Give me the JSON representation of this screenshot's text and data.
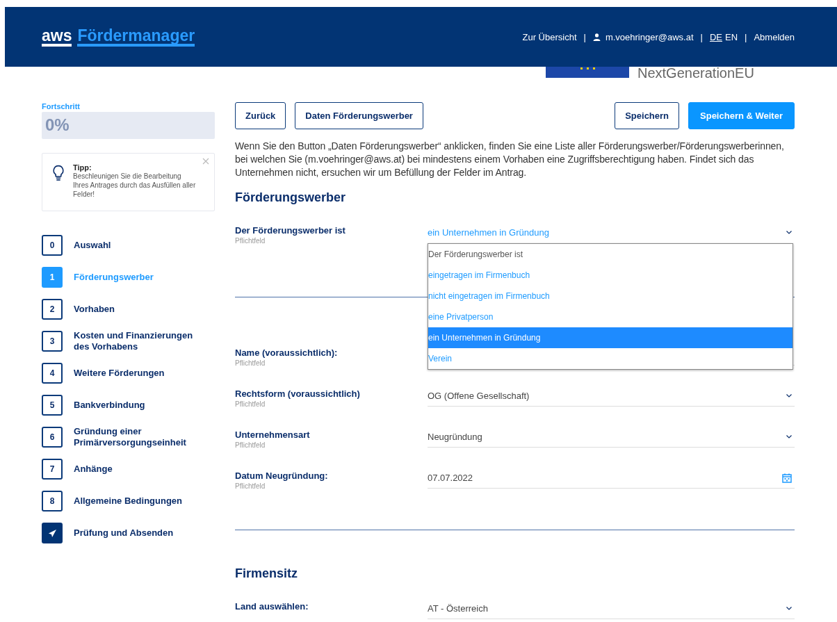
{
  "header": {
    "logo": {
      "prefix": "aws",
      "name": "Fördermanager"
    },
    "overview_link": "Zur Übersicht",
    "separator": "|",
    "user": "m.voehringer@aws.at",
    "languages": [
      {
        "label": "DE",
        "selected": true
      },
      {
        "label": "EN",
        "selected": false
      }
    ],
    "logout": "Abmelden"
  },
  "banner": {
    "text": "NextGenerationEU"
  },
  "progress": {
    "label": "Fortschritt",
    "value": "0%",
    "level": 0
  },
  "tip": {
    "title": "Tipp:",
    "text": "Beschleunigen Sie die Bearbeitung Ihres Antrages durch das Ausfüllen aller Felder!"
  },
  "steps": [
    {
      "number": "0",
      "label": "Auswahl",
      "kind": "number",
      "selected": false
    },
    {
      "number": "1",
      "label": "Förderungswerber",
      "kind": "number",
      "selected": true
    },
    {
      "number": "2",
      "label": "Vorhaben",
      "kind": "number",
      "selected": false
    },
    {
      "number": "3",
      "label": "Kosten und Finanzierungen des Vorhabens",
      "kind": "number",
      "selected": false
    },
    {
      "number": "4",
      "label": "Weitere Förderungen",
      "kind": "number",
      "selected": false
    },
    {
      "number": "5",
      "label": "Bankverbindung",
      "kind": "number",
      "selected": false
    },
    {
      "number": "6",
      "label": "Gründung einer Primärversorgungseinheit",
      "kind": "number",
      "selected": false
    },
    {
      "number": "7",
      "label": "Anhänge",
      "kind": "number",
      "selected": false
    },
    {
      "number": "8",
      "label": "Allgemeine Bedingungen",
      "kind": "number",
      "selected": false
    },
    {
      "label": "Prüfung und Absenden",
      "kind": "submit",
      "selected": false
    }
  ],
  "toolbar": {
    "left": [
      {
        "label": "Zurück",
        "kind": "outline"
      },
      {
        "label": "Daten Förderungswerber",
        "kind": "outline"
      }
    ],
    "right": [
      {
        "label": "Speichern",
        "kind": "outline"
      },
      {
        "label": "Speichern & Weiter",
        "kind": "primary"
      }
    ]
  },
  "info": "Wenn Sie den Button „Daten Förderungswerber“ anklicken, finden Sie eine Liste aller Förderungswerber/Förderungswerberinnen, bei welchen Sie (m.voehringer@aws.at) bei mindestens einem Vorhaben eine Zugriffsberechtigung haben. Findet sich das Unternehmen nicht, ersuchen wir um Befüllung der Felder im Antrag.",
  "sections": [
    {
      "title": "Förderungswerber",
      "groups": [
        [
          {
            "label": "Der Förderungswerber ist",
            "hint": "Pflichtfeld",
            "kind": "select",
            "value": "ein Unternehmen in Gründung",
            "expanded": true,
            "options": [
              {
                "label": "Der Förderungswerber ist",
                "selected": false,
                "disabled": true
              },
              {
                "label": "eingetragen im Firmenbuch",
                "selected": false,
                "disabled": false
              },
              {
                "label": "nicht eingetragen im Firmenbuch",
                "selected": false,
                "disabled": false
              },
              {
                "label": "eine Privatperson",
                "selected": false,
                "disabled": false
              },
              {
                "label": "ein Unternehmen in Gründung",
                "selected": true,
                "disabled": false
              },
              {
                "label": "Verein",
                "selected": false,
                "disabled": false
              }
            ]
          }
        ],
        [
          {
            "label": "Name (voraussichtlich):",
            "hint": "Pflichtfeld",
            "kind": "text"
          },
          {
            "label": "Rechtsform (voraussichtlich)",
            "hint": "Pflichtfeld",
            "kind": "select",
            "value": "OG (Offene Gesellschaft)"
          },
          {
            "label": "Unternehmensart",
            "hint": "Pflichtfeld",
            "kind": "select",
            "value": "Neugründung"
          },
          {
            "label": "Datum Neugründung:",
            "hint": "Pflichtfeld",
            "kind": "date",
            "value": "07.07.2022"
          }
        ]
      ]
    },
    {
      "title": "Firmensitz",
      "groups": [
        [
          {
            "label": "Land auswählen:",
            "kind": "select",
            "value": "AT - Österreich"
          }
        ]
      ]
    }
  ]
}
